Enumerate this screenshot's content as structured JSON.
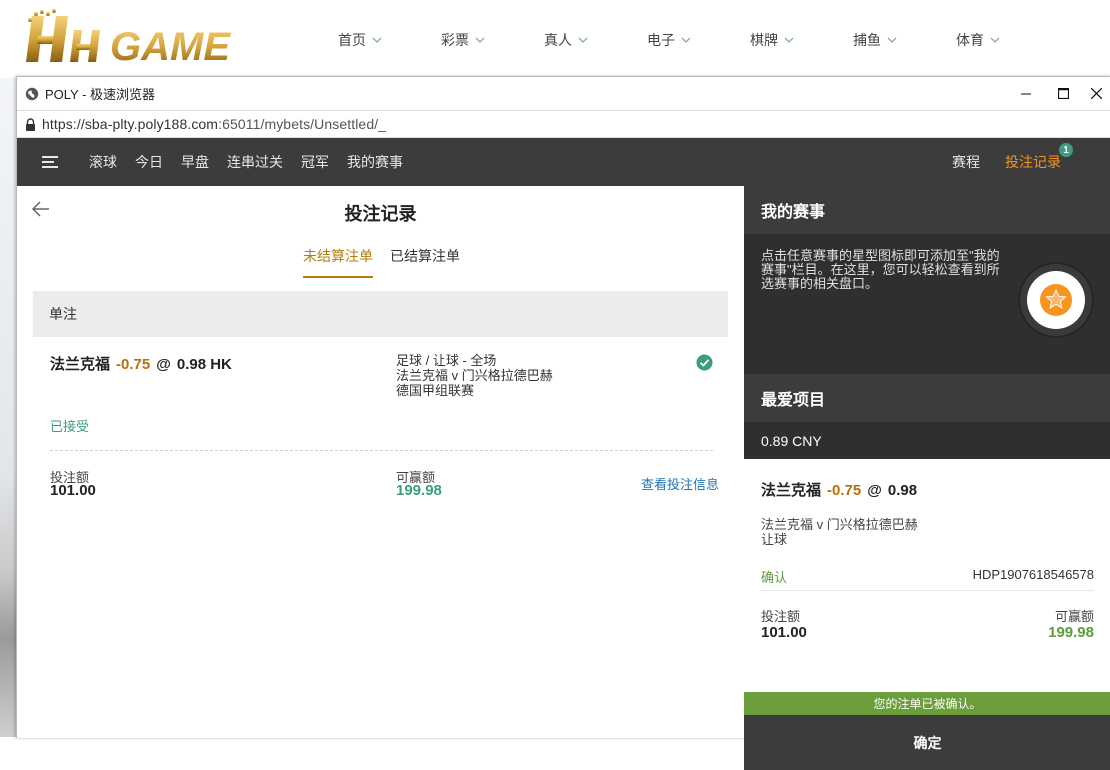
{
  "site": {
    "logo_text": "HH GAME",
    "nav": [
      "首页",
      "彩票",
      "真人",
      "电子",
      "棋牌",
      "捕鱼",
      "体育"
    ]
  },
  "browser": {
    "title": "POLY - 极速浏览器",
    "url_host": "https://sba-plty.poly188.com",
    "url_path": ":65011/mybets/Unsettled/_"
  },
  "topnav": {
    "links": [
      "滚球",
      "今日",
      "早盘",
      "连串过关",
      "冠军",
      "我的赛事"
    ],
    "schedule": "赛程",
    "bet_records": "投注记录",
    "badge": "1"
  },
  "bet_panel": {
    "title": "投注记录",
    "tabs": [
      "未结算注单",
      "已结算注单"
    ],
    "section": "单注",
    "bet": {
      "team": "法兰克福",
      "handicap": "-0.75",
      "at": "@",
      "odds": "0.98 HK",
      "market": "足球 / 让球 - 全场",
      "match": "法兰克福 v 门兴格拉德巴赫",
      "league": "德国甲组联赛",
      "status": "已接受",
      "stake_label": "投注额",
      "stake": "101.00",
      "win_label": "可赢额",
      "win": "199.98",
      "view_info": "查看投注信息"
    }
  },
  "my_events": {
    "title": "我的赛事",
    "desc": "点击任意赛事的星型图标即可添加至\"我的赛事\"栏目。在这里，您可以轻松查看到所选赛事的相关盘口。"
  },
  "favorites": {
    "title": "最爱项目",
    "balance": "0.89 CNY",
    "ticket": {
      "team": "法兰克福",
      "handicap": "-0.75",
      "at": "@",
      "odds": "0.98",
      "match": "法兰克福 v 门兴格拉德巴赫",
      "bet_type": "让球",
      "status": "确认",
      "ref": "HDP1907618546578",
      "stake_label": "投注额",
      "stake": "101.00",
      "win_label": "可赢额",
      "win": "199.98"
    },
    "confirm_msg": "您的注单已被确认。",
    "ok": "确定"
  },
  "colors": {
    "accent_orange": "#f7941d",
    "handicap": "#b8700b",
    "green": "#3b9e7c",
    "confirm_green": "#6b9e3b",
    "dark": "#3c3c3c"
  }
}
